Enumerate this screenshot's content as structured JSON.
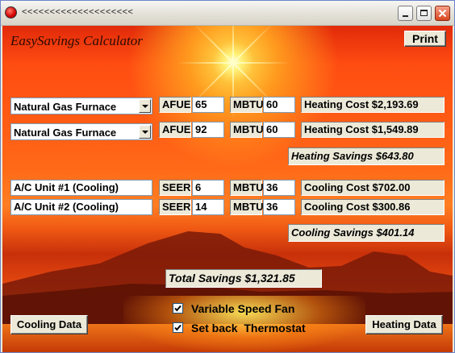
{
  "window": {
    "title": "<<<<<<<<<<<<<<<<<<<<",
    "controls": {
      "minimize": "minimize",
      "maximize": "maximize",
      "close": "close"
    }
  },
  "app": {
    "title": "EasySavings Calculator",
    "print_label": "Print"
  },
  "heating": {
    "rows": [
      {
        "system": "Natural Gas Furnace",
        "rating_label": "AFUE",
        "rating": "65",
        "mbtu_label": "MBTU",
        "mbtu": "60",
        "cost": "Heating Cost $2,193.69"
      },
      {
        "system": "Natural Gas Furnace",
        "rating_label": "AFUE",
        "rating": "92",
        "mbtu_label": "MBTU",
        "mbtu": "60",
        "cost": "Heating Cost $1,549.89"
      }
    ],
    "savings": "Heating Savings $643.80"
  },
  "cooling": {
    "rows": [
      {
        "unit": "A/C Unit #1 (Cooling)",
        "rating_label": "SEER",
        "rating": "6",
        "mbtu_label": "MBTU",
        "mbtu": "36",
        "cost": "Cooling Cost $702.00"
      },
      {
        "unit": "A/C Unit #2 (Cooling)",
        "rating_label": "SEER",
        "rating": "14",
        "mbtu_label": "MBTU",
        "mbtu": "36",
        "cost": "Cooling Cost $300.86"
      }
    ],
    "savings": "Cooling Savings $401.14"
  },
  "total_savings": "Total Savings $1,321.85",
  "options": {
    "variable_speed_fan": {
      "label": "Variable Speed Fan",
      "checked": true
    },
    "set_back_thermostat": {
      "label": "Set back  Thermostat",
      "checked": true
    }
  },
  "buttons": {
    "cooling_data": "Cooling Data",
    "heating_data": "Heating Data"
  },
  "icons": {
    "app": "app-icon",
    "check": "checkmark-icon"
  }
}
